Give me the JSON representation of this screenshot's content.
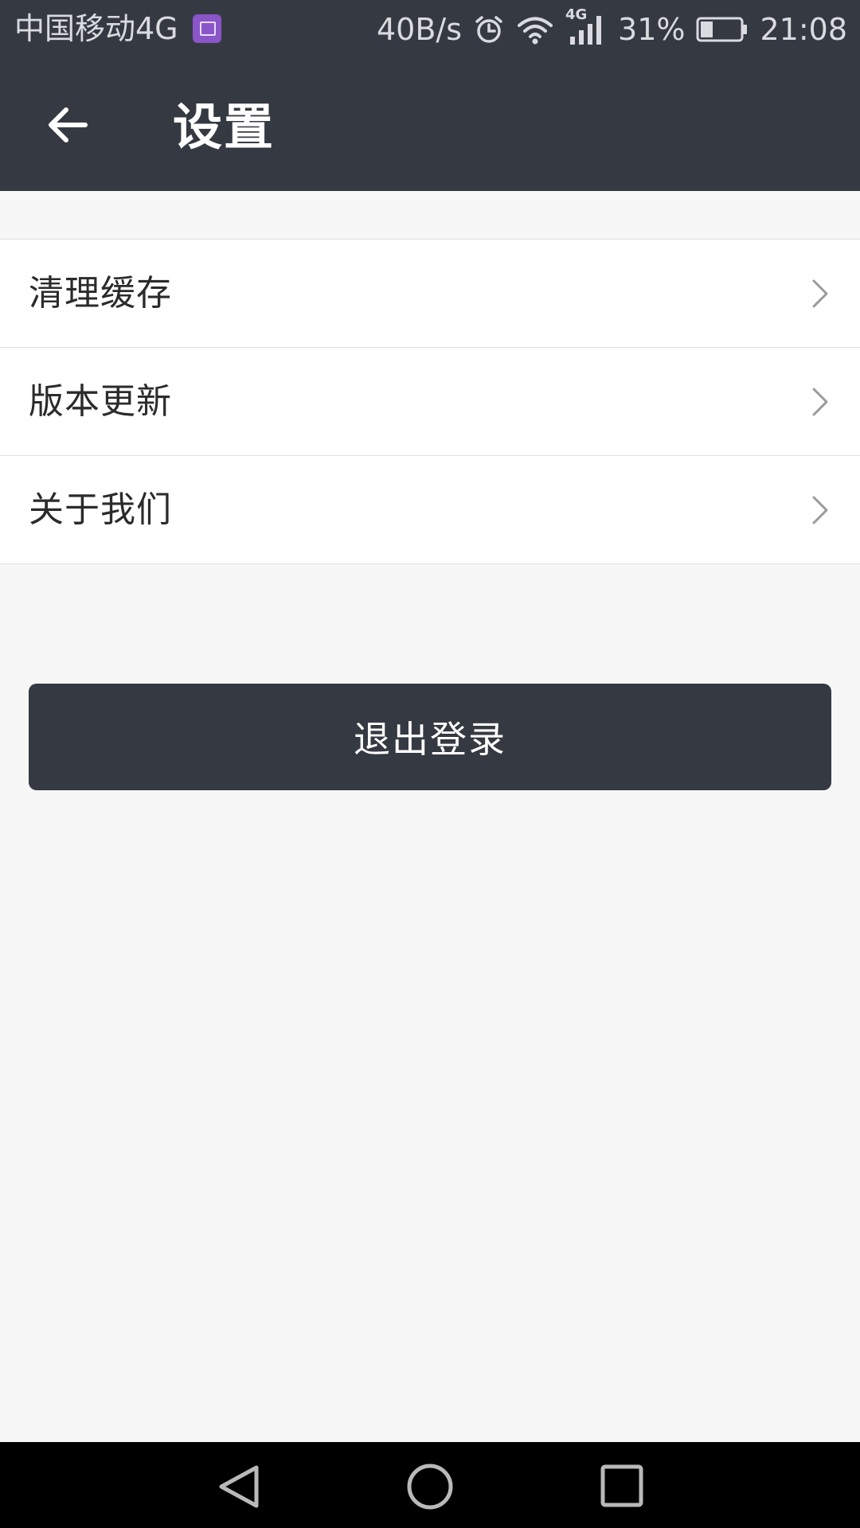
{
  "status_bar": {
    "carrier": "中国移动4G",
    "speed": "40B/s",
    "network_type": "4G",
    "battery_percent": "31%",
    "battery_level": 0.31,
    "time": "21:08",
    "icons": [
      "image-notification-icon",
      "alarm-icon",
      "wifi-icon",
      "signal-icon",
      "battery-icon"
    ]
  },
  "header": {
    "title": "设置",
    "back_icon": "arrow-left-icon"
  },
  "settings": {
    "items": [
      {
        "label": "清理缓存"
      },
      {
        "label": "版本更新"
      },
      {
        "label": "关于我们"
      }
    ]
  },
  "actions": {
    "logout_label": "退出登录"
  },
  "nav_bar": {
    "icons": [
      "back-triangle-icon",
      "home-circle-icon",
      "recents-square-icon"
    ]
  },
  "colors": {
    "header_bg": "#353a42",
    "page_bg": "#f7f7f7",
    "list_bg": "#ffffff",
    "divider": "#dedede",
    "text_primary": "#2b2b2b",
    "button_bg": "#353a42",
    "button_text": "#ffffff"
  }
}
